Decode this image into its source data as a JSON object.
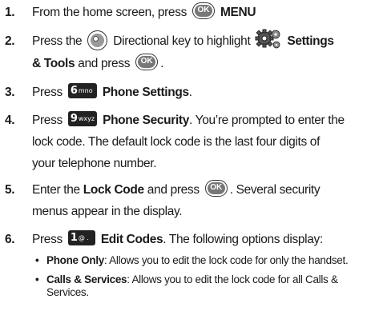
{
  "steps": [
    {
      "num": "1.",
      "pre": "From the home screen, press",
      "key": "MENU",
      "ok_label": "OK"
    },
    {
      "num": "2.",
      "t1": "Press the",
      "t2": "Directional key to highlight",
      "key": "Settings",
      "key2": "& Tools",
      "t3": "and press",
      "t4": ".",
      "ok_label": "OK"
    },
    {
      "num": "3.",
      "pre": "Press",
      "digit": "6",
      "letters": "mno",
      "key": "Phone Settings",
      "post": "."
    },
    {
      "num": "4.",
      "pre": "Press",
      "digit": "9",
      "letters": "wxyz",
      "key": "Phone Security",
      "post": ". You’re prompted to enter the",
      "line2": "lock code. The default lock code is the last four digits of",
      "line3": "your telephone number."
    },
    {
      "num": "5.",
      "pre": "Enter the",
      "key": "Lock Code",
      "mid": "and press",
      "post": ". Several security",
      "line2": "menus appear in the display.",
      "ok_label": "OK"
    },
    {
      "num": "6.",
      "pre": "Press",
      "digit": "1",
      "letters": "@ .",
      "key": "Edit Codes",
      "post": ". The following options display:"
    }
  ],
  "bullets": [
    {
      "term": "Phone Only",
      "text": ": Allows you to edit the lock code for only the handset."
    },
    {
      "term": "Calls & Services",
      "text": ": Allows you to edit the lock code for all Calls & Services."
    }
  ],
  "icons": {
    "ok": "ok-key-icon",
    "nav": "directional-key-icon",
    "settings": "settings-gear-icon",
    "keypad": "keypad-key-icon"
  }
}
